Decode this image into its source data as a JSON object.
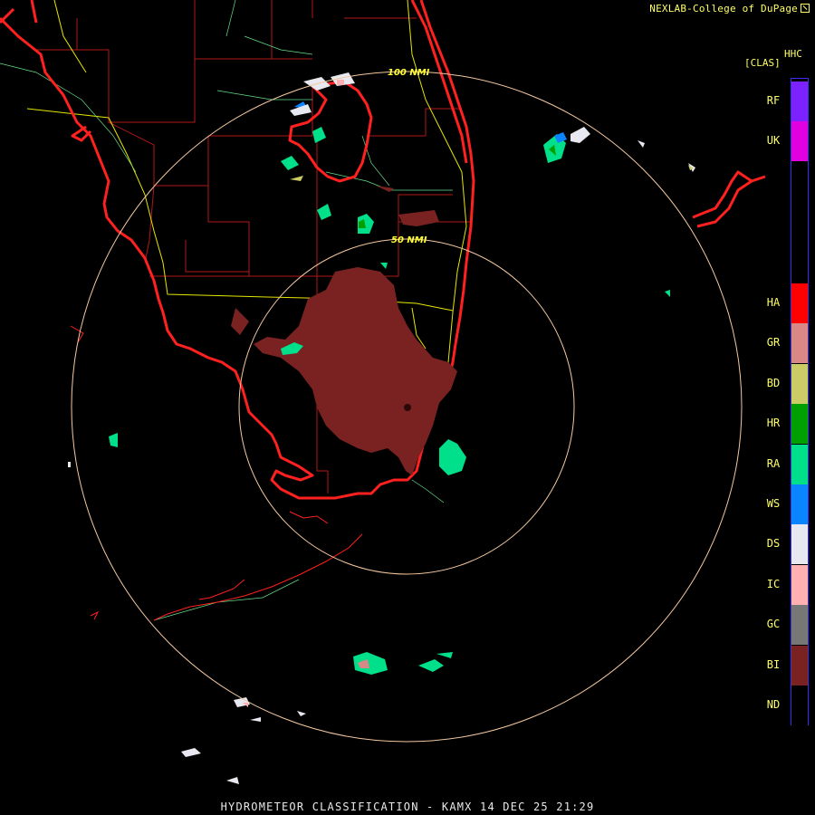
{
  "credit": "NEXLAB-College of DuPage",
  "product_code": "HHC",
  "product_class": "[CLAS]",
  "footer": "HYDROMETEOR CLASSIFICATION - KAMX 14 DEC 25 21:29",
  "range_rings": [
    {
      "label": "50 NMI"
    },
    {
      "label": "100 NMI"
    }
  ],
  "legend": [
    {
      "code": "RF",
      "color": "#7b22ff"
    },
    {
      "code": "UK",
      "color": "#e000e0"
    },
    {
      "code": "HA",
      "color": "#ff0000"
    },
    {
      "code": "GR",
      "color": "#d98888"
    },
    {
      "code": "BD",
      "color": "#cccc66"
    },
    {
      "code": "HR",
      "color": "#00a000"
    },
    {
      "code": "RA",
      "color": "#00e08a"
    },
    {
      "code": "WS",
      "color": "#0a84ff"
    },
    {
      "code": "DS",
      "color": "#e8e8f0"
    },
    {
      "code": "IC",
      "color": "#ffb0b0"
    },
    {
      "code": "GC",
      "color": "#777777"
    },
    {
      "code": "BI",
      "color": "#7a2222"
    },
    {
      "code": "ND",
      "color": "#000000"
    }
  ],
  "colors": {
    "coastline": "#ff2020",
    "county_lines": "#b01818",
    "roads": "#e6e600",
    "water_features": "#66dd88",
    "range_rings": "#f4c8a0"
  }
}
